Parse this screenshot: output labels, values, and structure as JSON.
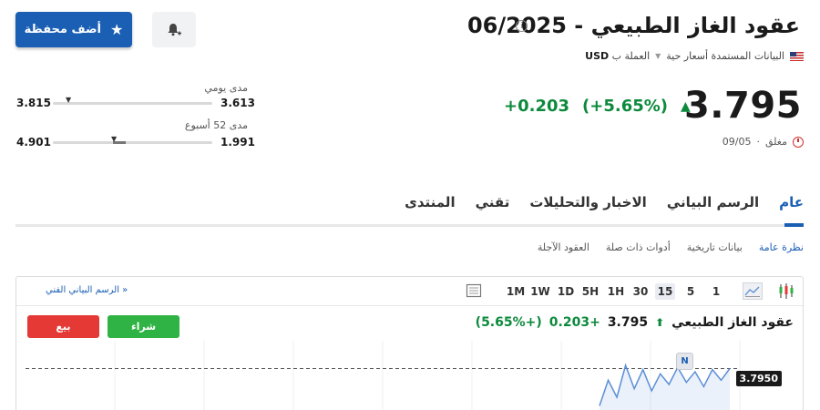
{
  "header": {
    "watchlist_button": "أضف محفظة",
    "title": "عقود الغاز الطبيعي - 06/2025",
    "realtime_label": "البيانات المستمدة أسعار حية",
    "currency_label": "العملة ب",
    "currency": "USD"
  },
  "quote": {
    "price": "3.795",
    "change": "+0.203",
    "change_pct": "(+5.65%)",
    "status": "مغلق",
    "date": "09/05"
  },
  "ranges": {
    "daily": {
      "label": "مدى يومي",
      "low": "3.613",
      "high": "3.815",
      "position": 0.9
    },
    "week52": {
      "label": "مدى 52 أسبوع",
      "low": "1.991",
      "high": "4.901",
      "position": 0.62
    }
  },
  "tabs": [
    "عام",
    "الرسم البياني",
    "الاخبار والتحليلات",
    "تقني",
    "المنتدى"
  ],
  "subtabs": [
    "نظرة عامة",
    "بيانات تاريخية",
    "أدوات ذات صلة",
    "العقود الآجلة"
  ],
  "chart_panel": {
    "timeframes": [
      "1",
      "5",
      "15",
      "30",
      "1H",
      "5H",
      "1D",
      "1W",
      "1M"
    ],
    "active_timeframe": "15",
    "tech_chart_link": "الرسم البياني الفني »",
    "sell_label": "بيع",
    "buy_label": "شراء",
    "instrument": "عقود الغاز الطبيعي",
    "price": "3.795",
    "change": "+0.203",
    "change_pct": "(+5.65%)",
    "price_tag": "3.7950",
    "news_marker": "N"
  },
  "colors": {
    "accent": "#1a5fb4",
    "positive": "#0c8a3c",
    "sell": "#e53935",
    "buy": "#2fb344"
  },
  "chart_data": {
    "type": "line",
    "y": [
      3.62,
      3.74,
      3.66,
      3.81,
      3.7,
      3.79,
      3.69,
      3.77,
      3.72,
      3.8,
      3.73,
      3.78,
      3.71,
      3.79,
      3.74,
      3.795
    ],
    "last_value": 3.795,
    "ylim": [
      3.6,
      3.9
    ]
  }
}
